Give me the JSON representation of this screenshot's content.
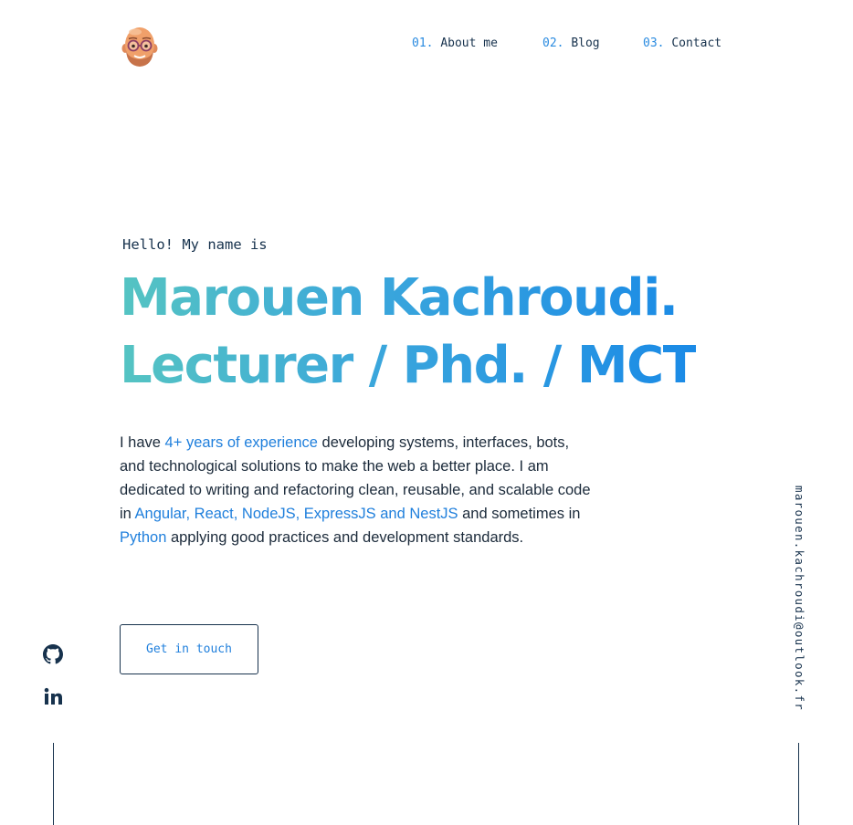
{
  "header": {
    "avatar_icon": "memoji-avatar-icon",
    "nav": [
      {
        "number": "01.",
        "label": "About me"
      },
      {
        "number": "02.",
        "label": "Blog"
      },
      {
        "number": "03.",
        "label": "Contact"
      }
    ]
  },
  "hero": {
    "greeting": "Hello! My name is",
    "name": "Marouen Kachroudi.",
    "role": "Lecturer / Phd. / MCT",
    "bio": {
      "t1": "I have ",
      "h1": "4+ years of experience",
      "t2": " developing systems, interfaces, bots, and technological solutions to make the web a better place. I am dedicated to writing and refactoring clean, reusable, and scalable code in ",
      "h2": "Angular, React, NodeJS, ExpressJS and NestJS",
      "t3": " and sometimes in ",
      "h3": "Python",
      "t4": " applying good practices and development standards."
    },
    "cta_label": "Get in touch"
  },
  "sidebar": {
    "socials": [
      {
        "icon": "github-icon"
      },
      {
        "icon": "linkedin-icon"
      }
    ],
    "email": "marouen.kachroudi@outlook.fr"
  },
  "colors": {
    "accent": "#1f7fdc",
    "navy": "#17324d",
    "gradient_start": "#55c4c2",
    "gradient_end": "#1a8ae6"
  }
}
